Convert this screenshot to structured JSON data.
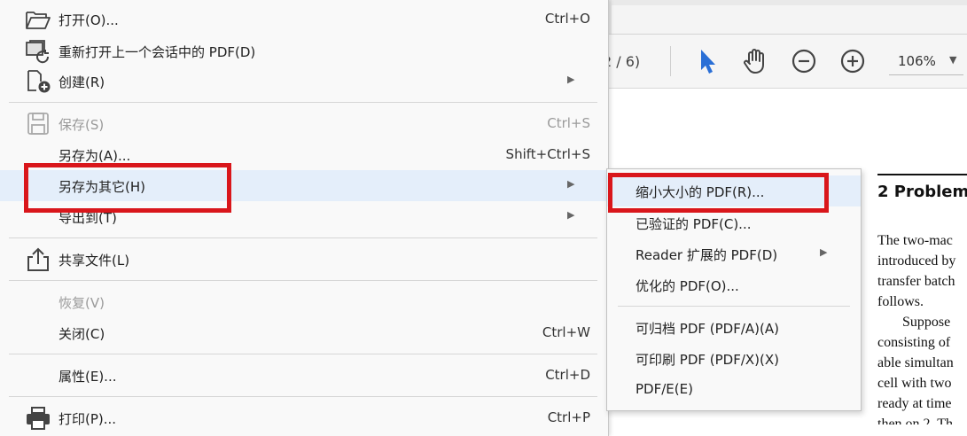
{
  "toolbar": {
    "page_count": "2 / 6)",
    "zoom": "106%"
  },
  "document": {
    "heading": "2  Problem",
    "lines": [
      "The two-mac",
      "introduced by",
      "transfer batch",
      "follows.",
      "Suppose",
      "consisting of",
      "able simultan",
      "cell with two",
      "ready at time",
      "then on 2. Th"
    ]
  },
  "menu": {
    "items": [
      {
        "label": "打开(O)...",
        "shortcut": "Ctrl+O"
      },
      {
        "label": "重新打开上一个会话中的 PDF(D)",
        "shortcut": ""
      },
      {
        "label": "创建(R)",
        "shortcut": ""
      },
      {
        "label": "保存(S)",
        "shortcut": "Ctrl+S"
      },
      {
        "label": "另存为(A)...",
        "shortcut": "Shift+Ctrl+S"
      },
      {
        "label": "另存为其它(H)",
        "shortcut": ""
      },
      {
        "label": "导出到(T)",
        "shortcut": ""
      },
      {
        "label": "共享文件(L)",
        "shortcut": ""
      },
      {
        "label": "恢复(V)",
        "shortcut": ""
      },
      {
        "label": "关闭(C)",
        "shortcut": "Ctrl+W"
      },
      {
        "label": "属性(E)...",
        "shortcut": "Ctrl+D"
      },
      {
        "label": "打印(P)...",
        "shortcut": "Ctrl+P"
      }
    ]
  },
  "submenu": {
    "items": [
      {
        "label": "缩小大小的 PDF(R)..."
      },
      {
        "label": "已验证的 PDF(C)..."
      },
      {
        "label": "Reader 扩展的 PDF(D)"
      },
      {
        "label": "优化的 PDF(O)..."
      },
      {
        "label": "可归档 PDF (PDF/A)(A)"
      },
      {
        "label": "可印刷 PDF (PDF/X)(X)"
      },
      {
        "label": "PDF/E(E)"
      }
    ]
  },
  "icons": [
    "folder-open-icon",
    "reopen-pdf-icon",
    "create-pdf-icon",
    "save-icon",
    "share-icon",
    "printer-icon",
    "select-cursor-icon",
    "hand-tool-icon",
    "zoom-out-icon",
    "zoom-in-icon",
    "chevron-down-icon",
    "submenu-arrow-icon"
  ],
  "colors": {
    "highlight": "#e4eefa",
    "annotation_red": "#d9161b",
    "cursor_blue": "#2a6fd6"
  }
}
